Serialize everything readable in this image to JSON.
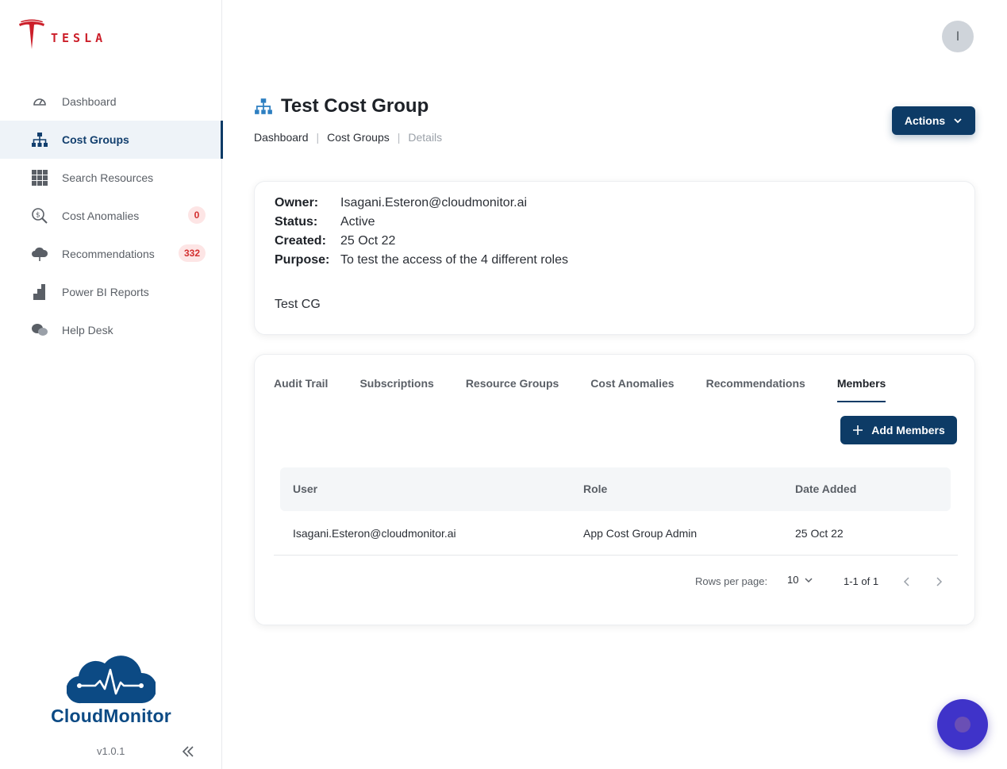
{
  "brand": {
    "wordmark": "TESLA",
    "brand_color": "#cc1f2a"
  },
  "sidebar": {
    "items": [
      {
        "label": "Dashboard",
        "icon": "speedometer-icon",
        "active": false
      },
      {
        "label": "Cost Groups",
        "icon": "hierarchy-icon",
        "active": true
      },
      {
        "label": "Search Resources",
        "icon": "grid-icon",
        "active": false
      },
      {
        "label": "Cost Anomalies",
        "icon": "dollar-search-icon",
        "active": false,
        "badge": "0"
      },
      {
        "label": "Recommendations",
        "icon": "cloud-icon",
        "active": false,
        "badge": "332"
      },
      {
        "label": "Power BI Reports",
        "icon": "bar-chart-icon",
        "active": false
      },
      {
        "label": "Help Desk",
        "icon": "chat-bubbles-icon",
        "active": false
      }
    ],
    "footer": {
      "product_name": "CloudMonitor",
      "version": "v1.0.1"
    }
  },
  "header": {
    "avatar_initial": "I"
  },
  "page": {
    "title": "Test Cost Group",
    "breadcrumb": [
      "Dashboard",
      "Cost Groups",
      "Details"
    ],
    "actions_label": "Actions"
  },
  "details": {
    "owner_label": "Owner:",
    "owner": "Isagani.Esteron@cloudmonitor.ai",
    "status_label": "Status:",
    "status": "Active",
    "created_label": "Created:",
    "created": "25 Oct 22",
    "purpose_label": "Purpose:",
    "purpose": "To test the access of the 4 different roles",
    "note": "Test CG"
  },
  "tabs": {
    "items": [
      "Audit Trail",
      "Subscriptions",
      "Resource Groups",
      "Cost Anomalies",
      "Recommendations",
      "Members"
    ],
    "active": "Members"
  },
  "members": {
    "add_label": "Add Members",
    "columns": [
      "User",
      "Role",
      "Date Added"
    ],
    "rows": [
      {
        "user": "Isagani.Esteron@cloudmonitor.ai",
        "role": "App Cost Group Admin",
        "date_added": "25 Oct 22"
      }
    ]
  },
  "pagination": {
    "rows_per_page_label": "Rows per page:",
    "rows_per_page": "10",
    "range": "1-1 of 1"
  },
  "colors": {
    "primary": "#0d3b66",
    "badge_bg": "#fde5e5",
    "badge_text": "#d32f2f",
    "fab": "#3f33c9"
  }
}
